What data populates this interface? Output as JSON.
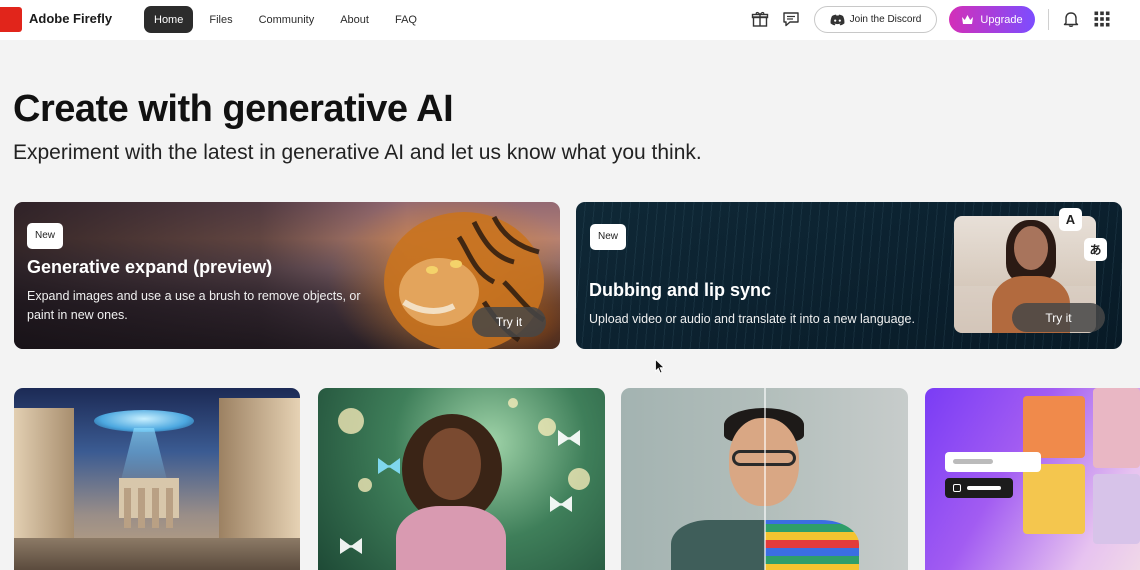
{
  "header": {
    "brand": "Adobe Firefly",
    "nav": [
      {
        "label": "Home",
        "active": true
      },
      {
        "label": "Files",
        "active": false
      },
      {
        "label": "Community",
        "active": false
      },
      {
        "label": "About",
        "active": false
      },
      {
        "label": "FAQ",
        "active": false
      }
    ],
    "icons": [
      "gift-icon",
      "feedback-icon",
      "bell-icon",
      "apps-grid-icon"
    ],
    "discord_label": "Join the Discord",
    "upgrade_label": "Upgrade"
  },
  "hero": {
    "title": "Create with generative AI",
    "subtitle": "Experiment with the latest in generative AI and let us know what you think."
  },
  "features": [
    {
      "badge": "New",
      "title": "Generative expand (preview)",
      "description": "Expand images and use a use a brush to remove objects, or paint in new ones.",
      "cta": "Try it"
    },
    {
      "badge": "New",
      "title": "Dubbing and lip sync",
      "description": "Upload video or audio and translate it into a new language.",
      "cta": "Try it",
      "lang_chips": [
        "A",
        "あ"
      ]
    }
  ],
  "colors": {
    "brand_red": "#e1251b",
    "nav_active_bg": "#2c2c2c",
    "upgrade_gradient_start": "#d32fb8",
    "upgrade_gradient_end": "#7c4dff",
    "page_bg": "#f3f3f3"
  }
}
